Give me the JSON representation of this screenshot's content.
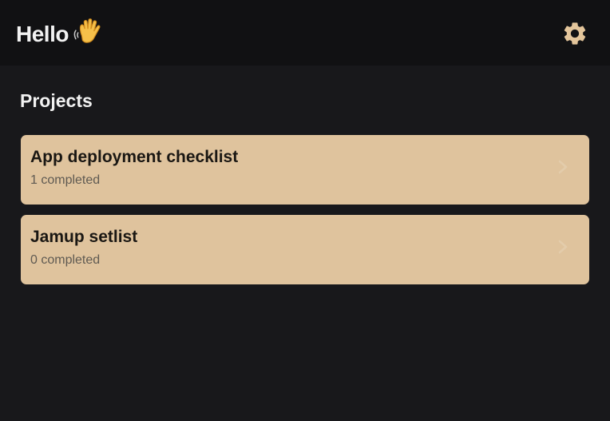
{
  "header": {
    "greeting": "Hello",
    "greeting_icon": "waving-hand-icon",
    "settings_icon": "gear-icon"
  },
  "projects": {
    "section_title": "Projects",
    "items": [
      {
        "name": "App deployment checklist",
        "status": "1 completed"
      },
      {
        "name": "Jamup setlist",
        "status": "0 completed"
      }
    ]
  },
  "colors": {
    "background": "#18181b",
    "header_background": "#111113",
    "card_background": "#dfc39d",
    "accent_gear": "#e3c59b",
    "card_title_text": "#1a1713",
    "card_subtitle_text": "#5f5a52"
  }
}
